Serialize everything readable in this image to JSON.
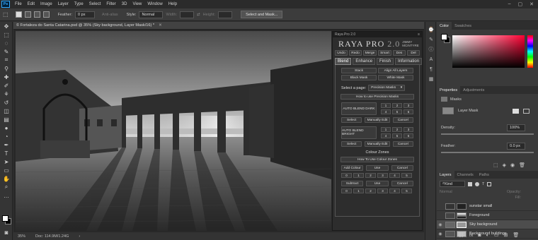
{
  "menu": {
    "logo": "Ps",
    "items": [
      "File",
      "Edit",
      "Image",
      "Layer",
      "Type",
      "Select",
      "Filter",
      "3D",
      "View",
      "Window",
      "Help"
    ],
    "window_controls": [
      "–",
      "▢",
      "✕"
    ]
  },
  "options": {
    "feather_label": "Feather:",
    "feather_value": "0 px",
    "antialias_label": "Anti-alias",
    "style_label": "Style:",
    "style_value": "Normal",
    "width_label": "Width:",
    "height_label": "Height:",
    "select_mask_button": "Select and Mask..."
  },
  "document": {
    "tab_title": "© Fortaleza do Santa Catarina.psd @ 35% (Sky background, Layer Mask/16) *",
    "zoom": "35%",
    "doc_size": "Doc: 114.9M/1.24G"
  },
  "raya": {
    "header": "Raya Pro 2.0",
    "brand": "RAYA PRO",
    "brand_version": "2.0",
    "brand_author": "JIMMY MCINTYRE",
    "top_buttons": [
      "Undo",
      "Redo",
      "Merge",
      "Smart",
      "Des",
      "Del"
    ],
    "tabs": [
      "Blend",
      "Enhance",
      "Finish",
      "Information"
    ],
    "active_tab": "Blend",
    "stack_button": "Stack",
    "align_button": "Align All Layers",
    "black_mask_button": "Black Mask",
    "white_mask_button": "White Mask",
    "select_page_label": "Select a page:",
    "page_select_value": "Precision Masks",
    "how_precision_button": "How to use Precision Masks",
    "auto_dark_label": "AUTO BLEND DARK",
    "auto_bright_label": "AUTO BLEND BRIGHT",
    "dark_numbers": [
      "1",
      "2",
      "3",
      "4",
      "5",
      "6"
    ],
    "bright_numbers": [
      "1",
      "2",
      "3",
      "4",
      "5",
      "6"
    ],
    "select_button": "Select",
    "manual_edit_button": "Manually Edit",
    "cancel_button": "Cancel",
    "colour_zones_label": "Colour Zones",
    "how_colour_button": "How To Use Colour Zones",
    "add_colour_button": "Add Colour",
    "use_button": "Use",
    "subtract_button": "Subtract",
    "zone_numbers": [
      "0",
      "1",
      "2",
      "3",
      "4",
      "5"
    ]
  },
  "panels": {
    "color_tabs": [
      "Color",
      "Swatches"
    ],
    "properties_tabs": [
      "Properties",
      "Adjustments"
    ],
    "masks_label": "Masks",
    "layer_mask_label": "Layer Mask",
    "density_label": "Density:",
    "density_value": "100%",
    "feather_label": "Feather:",
    "feather_value": "0.0 px",
    "layers_tabs": [
      "Layers",
      "Channels",
      "Paths"
    ],
    "kind_label": "Kind",
    "blend_mode": "Normal",
    "opacity_label": "Opacity:",
    "fill_label": "Fill:",
    "layers": [
      {
        "name": "sunstar small",
        "selected": false
      },
      {
        "name": "Foreground",
        "selected": false
      },
      {
        "name": "Sky background",
        "selected": true
      },
      {
        "name": "Background buildings",
        "selected": false
      }
    ]
  },
  "colors": {
    "accent": "#31a8ff",
    "panel_bg": "#3a3a3a"
  }
}
